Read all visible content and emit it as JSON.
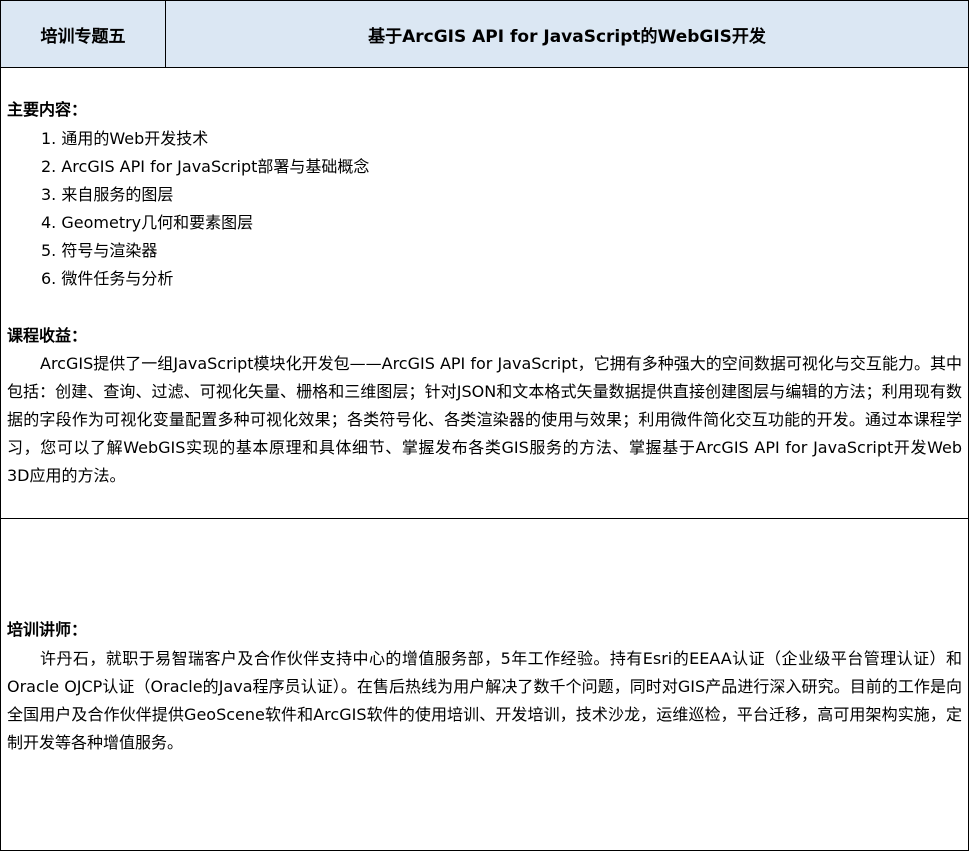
{
  "header": {
    "left": "培训专题五",
    "right": "基于ArcGIS API for JavaScript的WebGIS开发"
  },
  "content": {
    "label": "主要内容：",
    "items": [
      "1. 通用的Web开发技术",
      "2. ArcGIS API for JavaScript部署与基础概念",
      "3. 来自服务的图层",
      "4. Geometry几何和要素图层",
      "5. 符号与渲染器",
      "6. 微件任务与分析"
    ]
  },
  "benefits": {
    "label": "课程收益：",
    "text": "ArcGIS提供了一组JavaScript模块化开发包——ArcGIS API for JavaScript，它拥有多种强大的空间数据可视化与交互能力。其中包括：创建、查询、过滤、可视化矢量、栅格和三维图层；针对JSON和文本格式矢量数据提供直接创建图层与编辑的方法；利用现有数据的字段作为可视化变量配置多种可视化效果；各类符号化、各类渲染器的使用与效果；利用微件简化交互功能的开发。通过本课程学习，您可以了解WebGIS实现的基本原理和具体细节、掌握发布各类GIS服务的方法、掌握基于ArcGIS API for JavaScript开发Web 3D应用的方法。"
  },
  "instructor": {
    "label": "培训讲师：",
    "text": "许丹石，就职于易智瑞客户及合作伙伴支持中心的增值服务部，5年工作经验。持有Esri的EEAA认证（企业级平台管理认证）和Oracle OJCP认证（Oracle的Java程序员认证）。在售后热线为用户解决了数千个问题，同时对GIS产品进行深入研究。目前的工作是向全国用户及合作伙伴提供GeoScene软件和ArcGIS软件的使用培训、开发培训，技术沙龙，运维巡检，平台迁移，高可用架构实施，定制开发等各种增值服务。"
  }
}
